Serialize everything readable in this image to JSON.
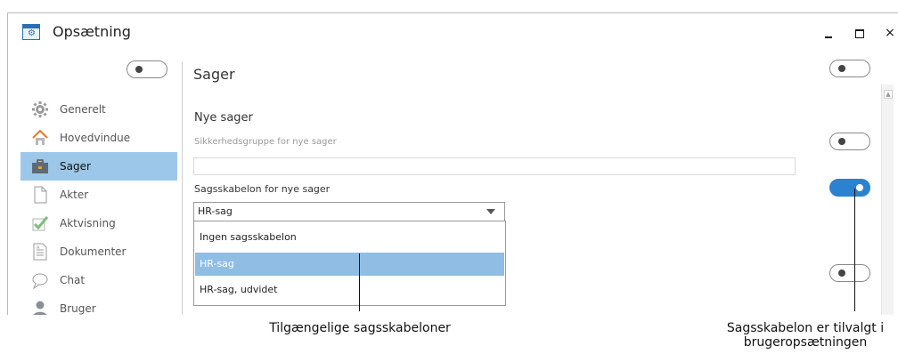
{
  "window": {
    "title": "Opsætning",
    "icon": "settings-gear-icon"
  },
  "window_controls": {
    "minimize": "minimize-icon",
    "maximize": "maximize-icon",
    "close": "×"
  },
  "sidebar": {
    "items": [
      {
        "label": "Generelt",
        "icon": "gear-icon",
        "active": false
      },
      {
        "label": "Hovedvindue",
        "icon": "home-icon",
        "active": false
      },
      {
        "label": "Sager",
        "icon": "briefcase-icon",
        "active": true
      },
      {
        "label": "Akter",
        "icon": "document-icon",
        "active": false
      },
      {
        "label": "Aktvisning",
        "icon": "checkmark-icon",
        "active": false
      },
      {
        "label": "Dokumenter",
        "icon": "text-document-icon",
        "active": false
      },
      {
        "label": "Chat",
        "icon": "chat-bubble-icon",
        "active": false
      },
      {
        "label": "Bruger",
        "icon": "user-icon",
        "active": false
      }
    ]
  },
  "main": {
    "section_title": "Sager",
    "subsection_title": "Nye sager",
    "security_group": {
      "label": "Sikkerhedsgruppe for nye sager",
      "value": ""
    },
    "template": {
      "label": "Sagsskabelon for nye sager",
      "selected": "HR-sag",
      "options": [
        "Ingen sagsskabelon",
        "HR-sag",
        "HR-sag, udvidet"
      ],
      "highlighted_option": "HR-sag"
    }
  },
  "toggles": [
    {
      "id": "sidebar",
      "on": false
    },
    {
      "id": "header",
      "on": false
    },
    {
      "id": "security_group",
      "on": false
    },
    {
      "id": "template",
      "on": true
    },
    {
      "id": "bottom",
      "on": false
    }
  ],
  "callouts": {
    "templates": "Tilgængelige sagsskabeloner",
    "preselected": "Sagsskabelon er tilvalgt i brugeropsætningen"
  },
  "colors": {
    "active_nav": "#9dc7e8",
    "selected_option": "#8fbde4",
    "toggle_on": "#2a82d0"
  }
}
